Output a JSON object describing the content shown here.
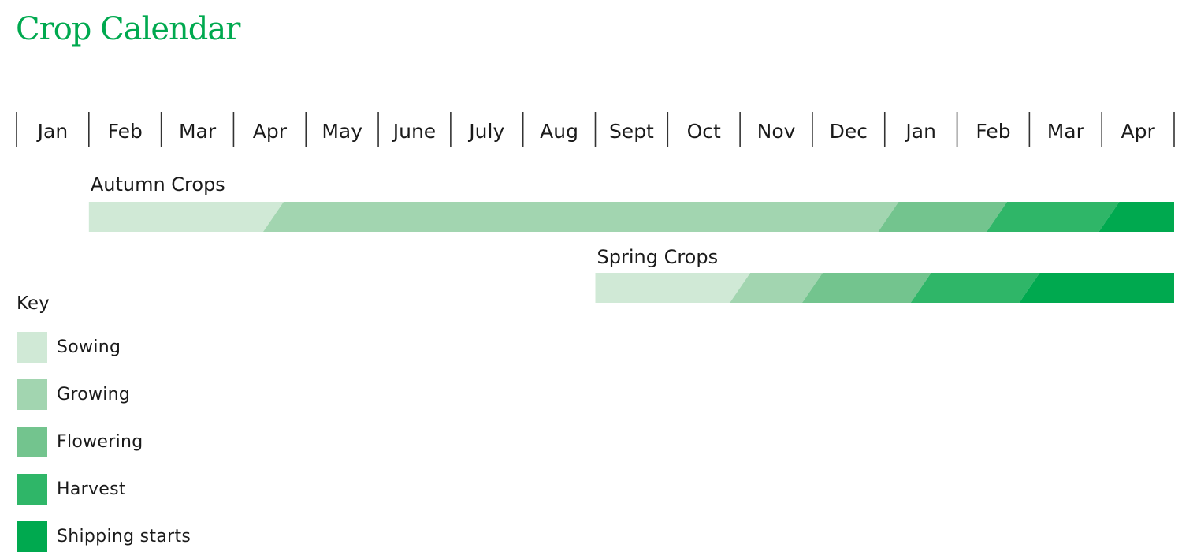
{
  "title": "Crop Calendar",
  "chart_data": {
    "type": "gantt",
    "title": "Crop Calendar",
    "months": [
      "Jan",
      "Feb",
      "Mar",
      "Apr",
      "May",
      "June",
      "July",
      "Aug",
      "Sept",
      "Oct",
      "Nov",
      "Dec",
      "Jan",
      "Feb",
      "Mar",
      "Apr"
    ],
    "x_unit": "months from start of first Jan",
    "x_range": [
      0,
      16
    ],
    "phases": [
      {
        "name": "Sowing",
        "color": "#d0e9d6"
      },
      {
        "name": "Growing",
        "color": "#a2d5b0"
      },
      {
        "name": "Flowering",
        "color": "#73c48e"
      },
      {
        "name": "Harvest",
        "color": "#2fb668"
      },
      {
        "name": "Shipping starts",
        "color": "#00a94f"
      }
    ],
    "series": [
      {
        "name": "Autumn Crops",
        "segments": [
          {
            "phase": "Sowing",
            "start": 1.0,
            "end": 3.55
          },
          {
            "phase": "Growing",
            "start": 3.55,
            "end": 12.05
          },
          {
            "phase": "Flowering",
            "start": 12.05,
            "end": 13.55
          },
          {
            "phase": "Harvest",
            "start": 13.55,
            "end": 15.1
          },
          {
            "phase": "Shipping starts",
            "start": 15.1,
            "end": 16.0
          }
        ]
      },
      {
        "name": "Spring Crops",
        "segments": [
          {
            "phase": "Sowing",
            "start": 8.0,
            "end": 10.0
          },
          {
            "phase": "Growing",
            "start": 10.0,
            "end": 11.0
          },
          {
            "phase": "Flowering",
            "start": 11.0,
            "end": 12.5
          },
          {
            "phase": "Harvest",
            "start": 12.5,
            "end": 14.0
          },
          {
            "phase": "Shipping starts",
            "start": 14.0,
            "end": 16.0
          }
        ]
      }
    ]
  },
  "key": {
    "title": "Key",
    "items": [
      {
        "label": "Sowing",
        "color": "#d0e9d6"
      },
      {
        "label": "Growing",
        "color": "#a2d5b0"
      },
      {
        "label": "Flowering",
        "color": "#73c48e"
      },
      {
        "label": "Harvest",
        "color": "#2fb668"
      },
      {
        "label": "Shipping starts",
        "color": "#00a94f"
      }
    ]
  }
}
